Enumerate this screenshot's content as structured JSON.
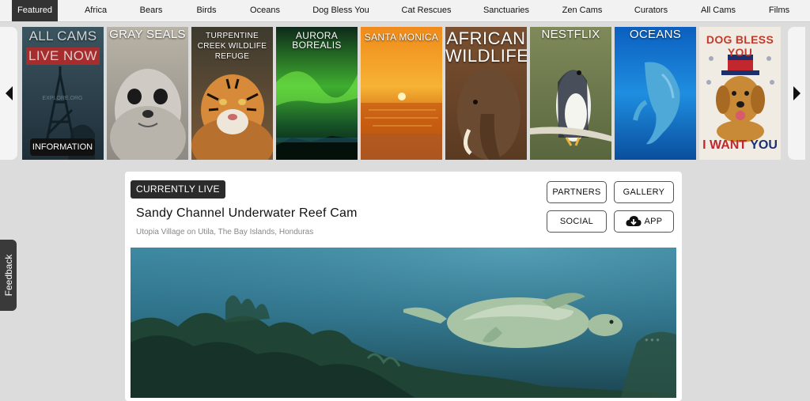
{
  "nav": {
    "items": [
      "Featured",
      "Africa",
      "Bears",
      "Birds",
      "Oceans",
      "Dog Bless You",
      "Cat Rescues",
      "Sanctuaries",
      "Zen Cams",
      "Curators",
      "All Cams",
      "Films"
    ],
    "active": "Featured"
  },
  "carousel": {
    "tiles": [
      {
        "label": "ALL CAMS",
        "badge": "LIVE NOW",
        "button": "INFORMATION",
        "watermark": "EXPLORE.ORG"
      },
      {
        "label": "GRAY SEALS"
      },
      {
        "label": "TURPENTINE CREEK WILDLIFE REFUGE"
      },
      {
        "label": "AURORA BOREALIS"
      },
      {
        "label": "SANTA MONICA"
      },
      {
        "label": "AFRICAN WILDLIFE"
      },
      {
        "label": "NESTFLIX"
      },
      {
        "label": "OCEANS"
      },
      {
        "label": "DOG BLESS YOU",
        "bottom_pre": "I WANT ",
        "bottom_accent": "YOU"
      }
    ],
    "prev_icon": "chevron-left-icon",
    "next_icon": "chevron-right-icon"
  },
  "panel": {
    "badge": "CURRENTLY LIVE",
    "title": "Sandy Channel Underwater Reef Cam",
    "location": "Utopia Village on Utila, The Bay Islands, Honduras",
    "buttons": {
      "partners": "PARTNERS",
      "gallery": "GALLERY",
      "social": "SOCIAL",
      "app": "APP",
      "app_icon": "cloud-download-icon"
    }
  },
  "feedback": {
    "label": "Feedback"
  },
  "colors": {
    "nav_active_bg": "#333333",
    "badge_bg": "#2b2b2b",
    "page_bg": "#dcdcdc",
    "live_red": "#b22a2a"
  }
}
